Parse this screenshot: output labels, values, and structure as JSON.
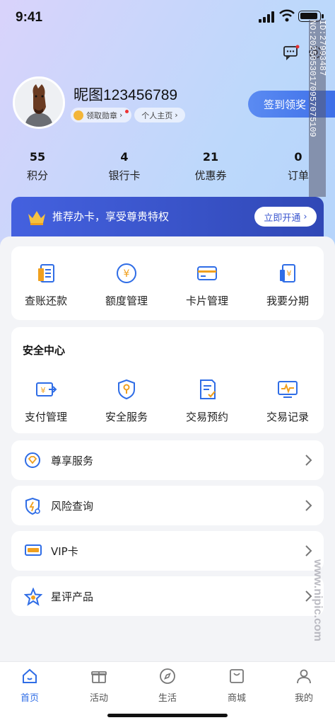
{
  "status": {
    "time": "9:41"
  },
  "profile": {
    "nickname": "昵图123456789",
    "badge_label": "领取勋章",
    "home_label": "个人主页",
    "checkin_label": "签到领奖"
  },
  "stats": [
    {
      "value": "55",
      "label": "积分"
    },
    {
      "value": "4",
      "label": "银行卡"
    },
    {
      "value": "21",
      "label": "优惠券"
    },
    {
      "value": "0",
      "label": "订单"
    }
  ],
  "vip_banner": {
    "text": "推荐办卡，享受尊贵特权",
    "button": "立即开通"
  },
  "quick_actions": [
    {
      "label": "查账还款",
      "icon": "bill-icon"
    },
    {
      "label": "额度管理",
      "icon": "yen-circle-icon"
    },
    {
      "label": "卡片管理",
      "icon": "card-icon"
    },
    {
      "label": "我要分期",
      "icon": "installment-icon"
    }
  ],
  "security": {
    "title": "安全中心",
    "items": [
      {
        "label": "支付管理",
        "icon": "payment-transfer-icon"
      },
      {
        "label": "安全服务",
        "icon": "shield-key-icon"
      },
      {
        "label": "交易预约",
        "icon": "appointment-doc-icon"
      },
      {
        "label": "交易记录",
        "icon": "record-monitor-icon"
      }
    ]
  },
  "menu_rows": [
    {
      "label": "尊享服务",
      "icon": "diamond-icon"
    },
    {
      "label": "风险查询",
      "icon": "risk-shield-icon"
    },
    {
      "label": "VIP卡",
      "icon": "vip-card-icon"
    },
    {
      "label": "星评产品",
      "icon": "star-icon"
    }
  ],
  "tabbar": [
    {
      "label": "首页",
      "icon": "home-icon",
      "active": true
    },
    {
      "label": "活动",
      "icon": "gift-icon",
      "active": false
    },
    {
      "label": "生活",
      "icon": "compass-icon",
      "active": false
    },
    {
      "label": "商城",
      "icon": "store-icon",
      "active": false
    },
    {
      "label": "我的",
      "icon": "user-icon",
      "active": false
    }
  ],
  "watermark": {
    "id_text": "ID:27993487 NO:20250530170957075109",
    "site_text": "www.nipic.com"
  },
  "colors": {
    "accent": "#2f6de6",
    "banner": "#3a52cc",
    "icon_orange": "#f0a01e"
  }
}
